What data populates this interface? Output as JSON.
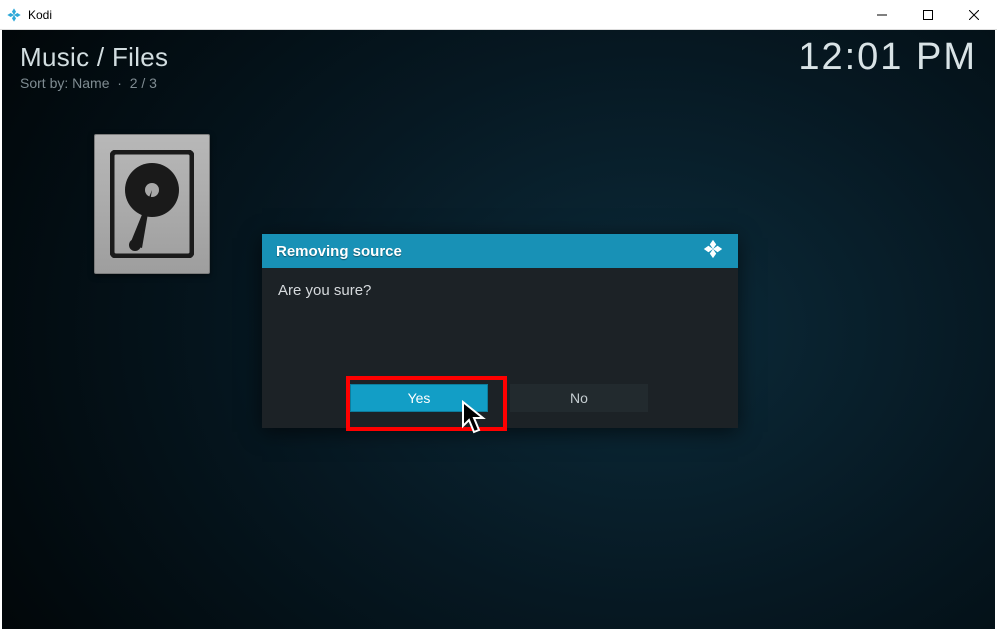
{
  "window": {
    "title": "Kodi"
  },
  "header": {
    "breadcrumb": "Music / Files",
    "sort_label": "Sort by: Name",
    "position": "2 / 3",
    "clock": "12:01 PM"
  },
  "dialog": {
    "title": "Removing source",
    "message": "Are you sure?",
    "yes_label": "Yes",
    "no_label": "No"
  }
}
